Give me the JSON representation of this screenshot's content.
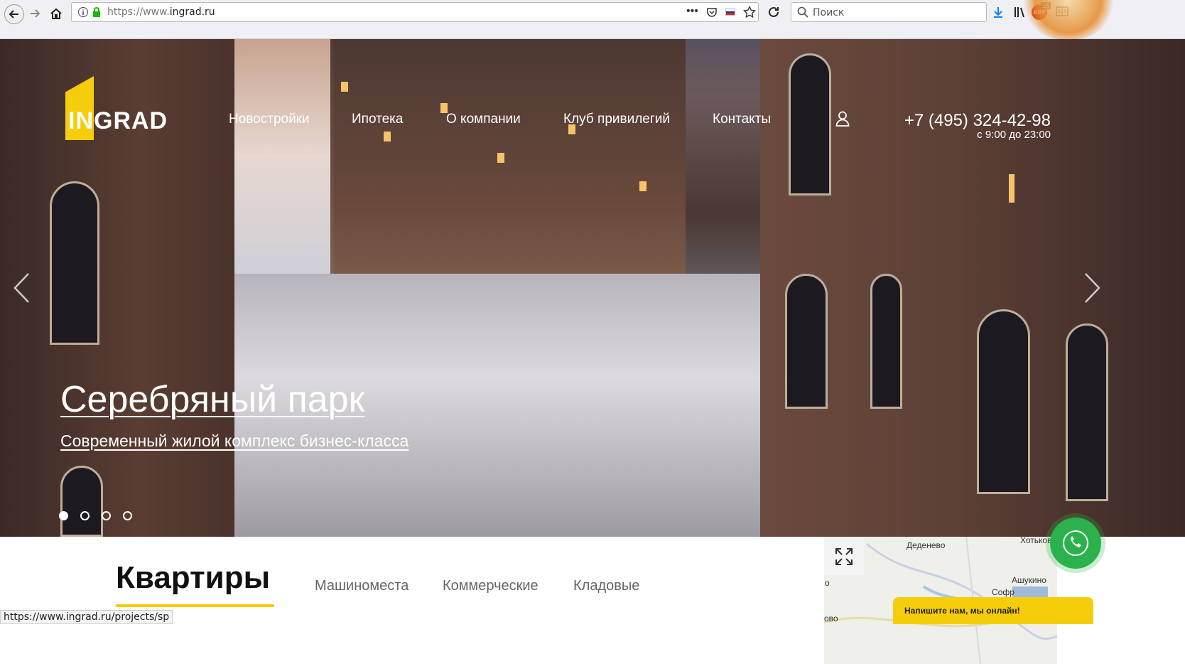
{
  "browser": {
    "url_protocol": "https://www.",
    "url_domain": "ingrad.ru",
    "search_placeholder": "Поиск",
    "badge_count": "16",
    "status_url": "https://www.ingrad.ru/projects/sp"
  },
  "site": {
    "logo_text": "INGRAD",
    "nav": [
      "Новостройки",
      "Ипотека",
      "О компании",
      "Клуб привилегий",
      "Контакты"
    ],
    "phone": "+7 (495) 324-42-98",
    "hours": "с 9:00 до 23:00",
    "brand_color": "#f6cd0a"
  },
  "hero": {
    "title": "Серебряный парк",
    "subtitle": "Современный жилой комплекс бизнес-класса",
    "slides_total": 4,
    "active_slide": 1
  },
  "tabs": {
    "active": "Квартиры",
    "items": [
      "Машиноместа",
      "Коммерческие",
      "Кладовые"
    ]
  },
  "map": {
    "labels": [
      "Деденево",
      "Хотьково",
      "Ашукино",
      "Софр",
      "о",
      "ово"
    ]
  },
  "chat": {
    "label": "Напишите нам, мы онлайн!",
    "call_color": "#2bb24c"
  }
}
